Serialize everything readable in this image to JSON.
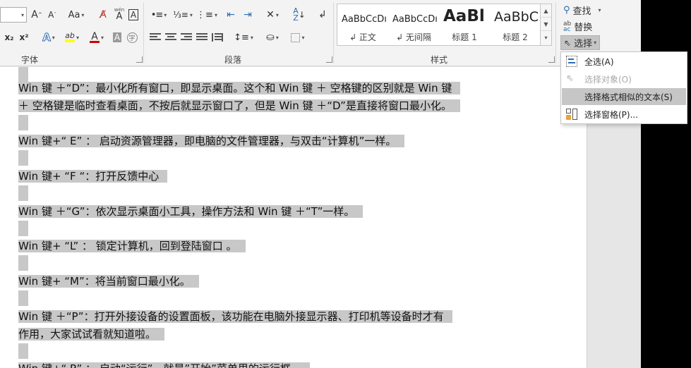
{
  "ribbon": {
    "font_group": {
      "label": "字体",
      "change_case_label": "Aa",
      "phonetic_label": "wén",
      "phonetic_base": "A",
      "border_char": "A",
      "subscript": "x₂",
      "superscript": "x²",
      "text_effect": "A",
      "highlight": "ab",
      "font_color": "A",
      "char_shading": "A",
      "enclose_char": "字",
      "grow_font": "A",
      "shrink_font": "A"
    },
    "paragraph_group": {
      "label": "段落"
    },
    "styles_group": {
      "label": "样式",
      "items": [
        {
          "sample": "AaBbCcDı",
          "name": "↲ 正文"
        },
        {
          "sample": "AaBbCcDı",
          "name": "↲ 无间隔"
        },
        {
          "sample": "AaBl",
          "name": "标题 1"
        },
        {
          "sample": "AaBbC",
          "name": "标题 2"
        }
      ]
    },
    "editing_group": {
      "find_label": "查找",
      "replace_label": "替换",
      "select_label": "选择"
    }
  },
  "select_menu": {
    "items": [
      {
        "label": "全选(A)",
        "icon": "select-all-icon",
        "state": "normal"
      },
      {
        "label": "选择对象(O)",
        "icon": "select-objects-icon",
        "state": "disabled"
      },
      {
        "label": "选择格式相似的文本(S)",
        "icon": "none",
        "state": "highlighted"
      },
      {
        "label": "选择窗格(P)...",
        "icon": "selection-pane-icon",
        "state": "normal"
      }
    ]
  },
  "document": {
    "lines": [
      "Win 键 ＋“D”：最小化所有窗口，即显示桌面。这个和 Win 键 ＋ 空格键的区别就是 Win 键",
      "＋ 空格键是临时查看桌面，不按后就显示窗口了，但是 Win 键 ＋“D”是直接将窗口最小化。",
      "Win 键+“ E” ： 启动资源管理器，即电脑的文件管理器，与双击“计算机”一样。",
      "Win 键+ “F “：打开反馈中心",
      "Win 键 ＋“G”：依次显示桌面小工具，操作方法和 Win 键 ＋“T”一样。",
      "Win 键+ “L” ： 锁定计算机，回到登陆窗口 。",
      "Win 键+ “M”：将当前窗口最小化。",
      "Win 键 ＋“P”：打开外接设备的设置面板，该功能在电脑外接显示器、打印机等设备时才有",
      "作用，大家试试看就知道啦。",
      "Win 键+“ R” ： 启动“运行”，就是”开始”菜单里的运行框。"
    ]
  }
}
